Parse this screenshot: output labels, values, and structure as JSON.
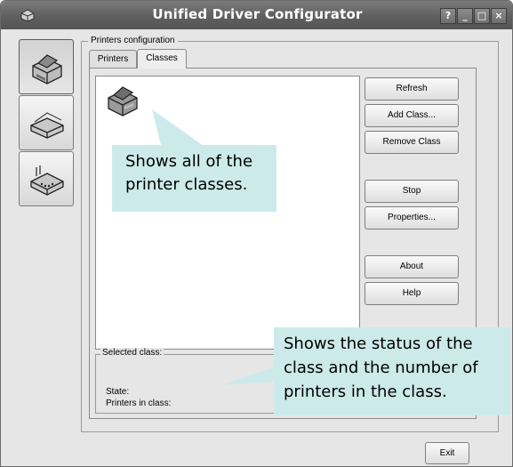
{
  "window": {
    "title": "Unified Driver Configurator",
    "controls": {
      "help": "?",
      "minimize": "_",
      "maximize": "□",
      "close": "×"
    }
  },
  "sidebar": {
    "items": [
      {
        "name": "printers-configuration",
        "icon": "printer-icon",
        "selected": true
      },
      {
        "name": "scanners-configuration",
        "icon": "scanner-icon",
        "selected": false
      },
      {
        "name": "ports-configuration",
        "icon": "port-icon",
        "selected": false
      }
    ]
  },
  "group": {
    "title": "Printers configuration"
  },
  "tabs": [
    {
      "label": "Printers",
      "active": false
    },
    {
      "label": "Classes",
      "active": true
    }
  ],
  "buttons": {
    "refresh": "Refresh",
    "add_class": "Add Class...",
    "remove_class": "Remove Class",
    "stop": "Stop",
    "properties": "Properties...",
    "about": "About",
    "help": "Help",
    "exit": "Exit"
  },
  "status": {
    "title": "Selected class:",
    "state_label": "State:",
    "printers_label": "Printers in class:"
  },
  "callouts": {
    "classes_line1": "Shows all of the",
    "classes_line2": "printer classes.",
    "status_line1": "Shows the status of the",
    "status_line2": "class and the number of",
    "status_line3": "printers in the class."
  },
  "colors": {
    "callout": "#cdeaea",
    "titlebar": "#5f5f5f",
    "window": "#e6e6e6"
  }
}
